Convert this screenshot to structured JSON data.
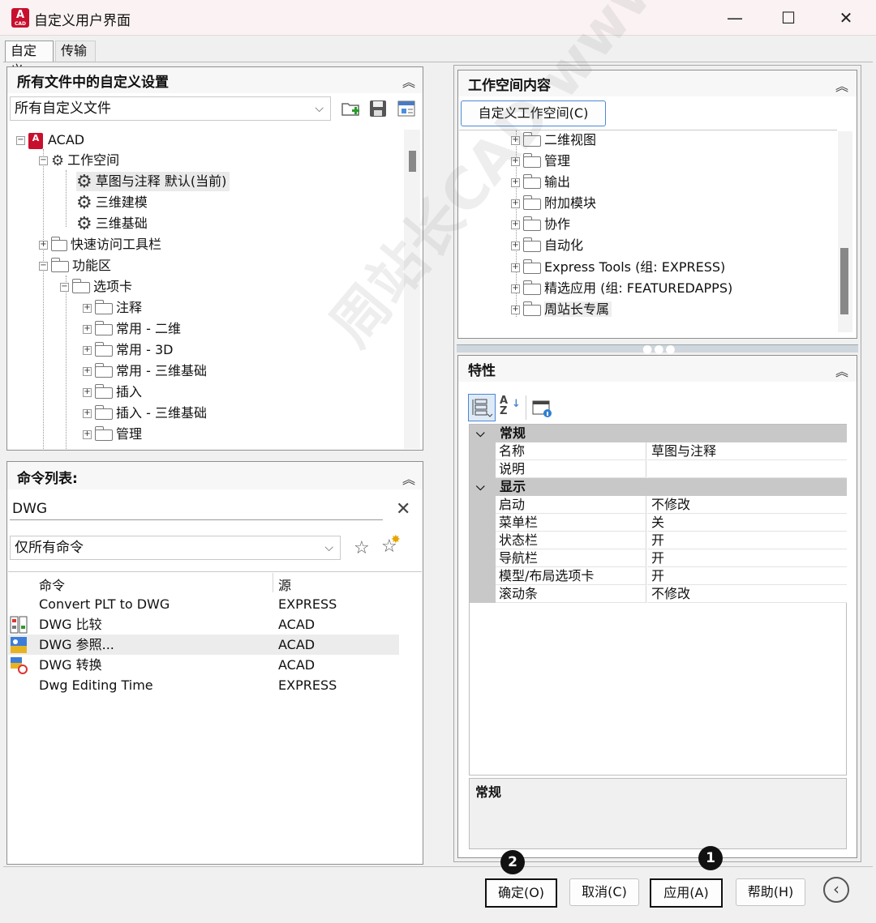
{
  "window": {
    "title": "自定义用户界面",
    "minimize_glyph": "—",
    "maximize_glyph": "☐",
    "close_glyph": "✕"
  },
  "tabs": [
    "自定义",
    "传输"
  ],
  "left_top": {
    "title": "所有文件中的自定义设置",
    "dropdown_value": "所有自定义文件",
    "tree": [
      {
        "label": "ACAD"
      },
      {
        "label": "工作空间"
      },
      {
        "label": "草图与注释 默认(当前)"
      },
      {
        "label": "三维建模"
      },
      {
        "label": "三维基础"
      },
      {
        "label": "快速访问工具栏"
      },
      {
        "label": "功能区"
      },
      {
        "label": "选项卡"
      },
      {
        "label": "注释"
      },
      {
        "label": "常用 - 二维"
      },
      {
        "label": "常用 - 3D"
      },
      {
        "label": "常用 - 三维基础"
      },
      {
        "label": "插入"
      },
      {
        "label": "插入 - 三维基础"
      },
      {
        "label": "管理"
      }
    ]
  },
  "command_list": {
    "title": "命令列表:",
    "search_value": "DWG",
    "filter_value": "仅所有命令",
    "columns": [
      "命令",
      "源"
    ],
    "rows": [
      {
        "command": "Convert PLT to DWG",
        "source": "EXPRESS"
      },
      {
        "command": "DWG 比较",
        "source": "ACAD"
      },
      {
        "command": "DWG 参照...",
        "source": "ACAD"
      },
      {
        "command": "DWG 转换",
        "source": "ACAD"
      },
      {
        "command": "Dwg Editing Time",
        "source": "EXPRESS"
      }
    ]
  },
  "workspace_contents": {
    "title": "工作空间内容",
    "customize_button": "自定义工作空间(C)",
    "items": [
      "二维视图",
      "管理",
      "输出",
      "附加模块",
      "协作",
      "自动化",
      "Express Tools (组: EXPRESS)",
      "精选应用 (组: FEATUREDAPPS)",
      "周站长专属"
    ]
  },
  "properties": {
    "title": "特性",
    "categories": [
      {
        "name": "常规",
        "props": [
          {
            "name": "名称",
            "value": "草图与注释"
          },
          {
            "name": "说明",
            "value": ""
          }
        ]
      },
      {
        "name": "显示",
        "props": [
          {
            "name": "启动",
            "value": "不修改"
          },
          {
            "name": "菜单栏",
            "value": "关"
          },
          {
            "name": "状态栏",
            "value": "开"
          },
          {
            "name": "导航栏",
            "value": "开"
          },
          {
            "name": "模型/布局选项卡",
            "value": "开"
          },
          {
            "name": "滚动条",
            "value": "不修改"
          }
        ]
      }
    ],
    "description_title": "常规"
  },
  "buttons": {
    "ok": "确定(O)",
    "cancel": "取消(C)",
    "apply": "应用(A)",
    "help": "帮助(H)"
  },
  "badges": {
    "ok": "2",
    "apply": "1"
  },
  "watermark": "周站长CAD www.zzzcad.com",
  "colors": {
    "acad_red": "#c8102e",
    "focus_border": "#111111"
  }
}
